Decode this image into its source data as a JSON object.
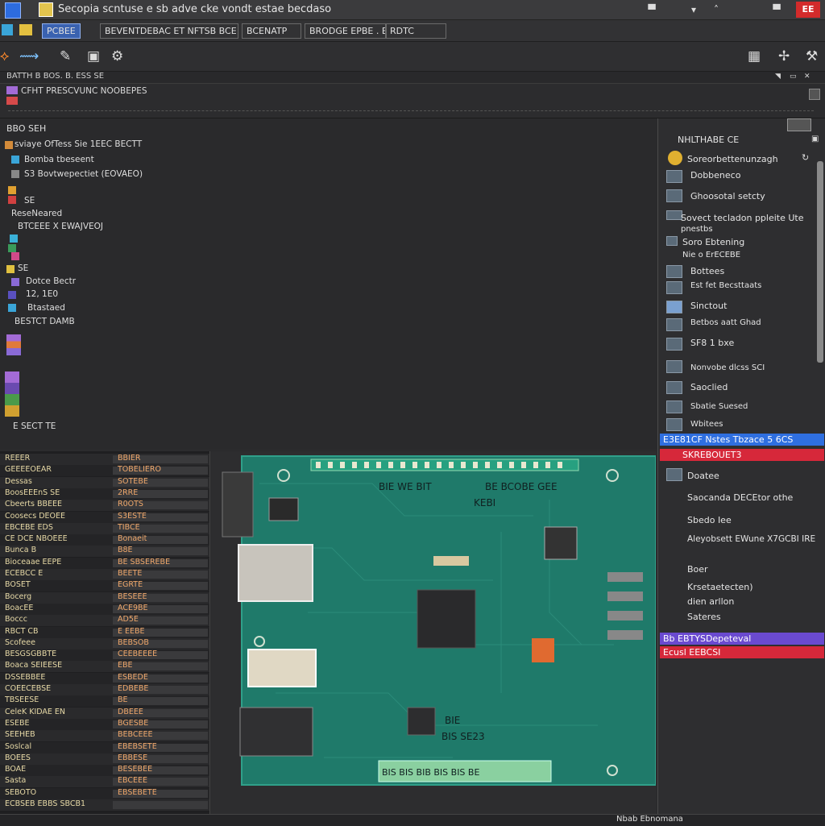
{
  "window": {
    "title": "Secopia scntuse e sb adve cke vondt estae becdaso",
    "close_label": "EE"
  },
  "menu": {
    "boxes": [
      "PCBEE",
      "BEVENTDEBAC  ET  NFTSB BCE",
      "BCENATP",
      "BRODGE EPBE  . ET",
      "RDTC"
    ]
  },
  "path_strip": "BATTH  B  BOS. B.  ESS  SE",
  "subheader": {
    "line1": "CFHT PRESCVUNC NOOBEPES"
  },
  "tree": {
    "title": "BBO SEH",
    "nodes": [
      "sviaye OfTess Sie 1EEC BECTT",
      "Bomba tbeseent",
      "S3 Bovtwepectiet (EOVAEO)",
      "SE",
      "ReseNeared",
      "BTCEEE X EWAJVEOJ",
      "SE",
      "Dotce Bectr",
      "12, 1E0",
      "Btastaed",
      "BESTCT DAMB",
      "E SECT TE"
    ]
  },
  "right_panel": {
    "header": "NHLTHABE  CE",
    "items": [
      "Soreorbettenunzagh",
      "Dobbeneco",
      "Ghoosotal   setcty",
      "Sovect tecladon ppleite Ute",
      "pnestbs",
      "Soro Ebtening",
      "Nie o ErECEBE",
      "Bottees",
      "Est fet Becsttaats",
      "Sinctout",
      "Betbos   aatt Ghad",
      "SF8 1 bxe",
      "Nonvobe dlcss  SCI",
      "Saoclied",
      "Sbatie Suesed",
      "Wbitees"
    ],
    "highlight_blue": "E3E81CF Nstes Tbzace 5 6CS",
    "highlight_red": "SKREBOUET3",
    "items2": [
      "Doatee",
      "Saocanda DECEtor othe",
      "Sbedo Iee",
      "Aleyobsett EWune X7GCBI IRE",
      "Boer",
      "Krsetaetecten)",
      "dien arllon",
      "Sateres"
    ],
    "highlight_purple": "Bb EBTYSDepeteval",
    "highlight_red2": "Ecusl EEBCSI"
  },
  "listing": {
    "rows": [
      [
        "REEER",
        "BBIER"
      ],
      [
        "GEEEEOEAR",
        "TOBELIERO"
      ],
      [
        "Dessas",
        "SOTEBE"
      ],
      [
        "BoosEEEnS  SE",
        "2RRE"
      ],
      [
        "Cbeerts BBEEE",
        "R0OTS"
      ],
      [
        "Coosecs DEOEE",
        "S3ESTE"
      ],
      [
        "EBCEBE EDS",
        "TIBCE"
      ],
      [
        "CE DCE NBOEEE",
        "Bonaeit"
      ],
      [
        "Bunca  B",
        "B8E"
      ],
      [
        "Bioceaae EEPE",
        "BE SBSEREBE"
      ],
      [
        "ECEBCC   E",
        "BEETE"
      ],
      [
        "BOSET",
        "EGRTE"
      ],
      [
        "Bocerg",
        "BESEEE"
      ],
      [
        "BoacEE",
        "ACE9BE"
      ],
      [
        "Boccc",
        "AD5E"
      ],
      [
        "RBCT  CB",
        "E EEBE"
      ],
      [
        "Scofeee",
        "BEBSOB"
      ],
      [
        "BESGSGBBTE",
        "CEEBEEEE"
      ],
      [
        "Boaca  SEIEESE",
        "EBE"
      ],
      [
        "DSSEBBEE",
        "ESBEDE"
      ],
      [
        "COEECEBSE",
        "EDBEBE"
      ],
      [
        "TBSEESE",
        "BE"
      ],
      [
        "CeleK KIDAE EN",
        "DBEEE"
      ],
      [
        "ESEBE",
        "BGESBE"
      ],
      [
        "SEEHEB",
        "BEBCEEE"
      ],
      [
        "Soslcal",
        "EBEBSETE"
      ],
      [
        "BOEES",
        "EBBESE"
      ],
      [
        "BOAE",
        "BESEBEE"
      ],
      [
        "Sasta",
        "EBCEEE"
      ],
      [
        "SEBOTO",
        "EBSEBETE"
      ],
      [
        "ECBSEB  EBBS  SBCB1",
        ""
      ]
    ]
  },
  "board": {
    "label_top": "BIE  WE   BIT",
    "label_top2": "BE BCOBE   GEE",
    "label_mid": "KEBI",
    "label_bottom1": "BIE",
    "label_bottom2": "BIS SE23",
    "terminal_text": "BIS BIS BIB BIS BIS BE"
  },
  "status": "Nbab Ebnomana"
}
